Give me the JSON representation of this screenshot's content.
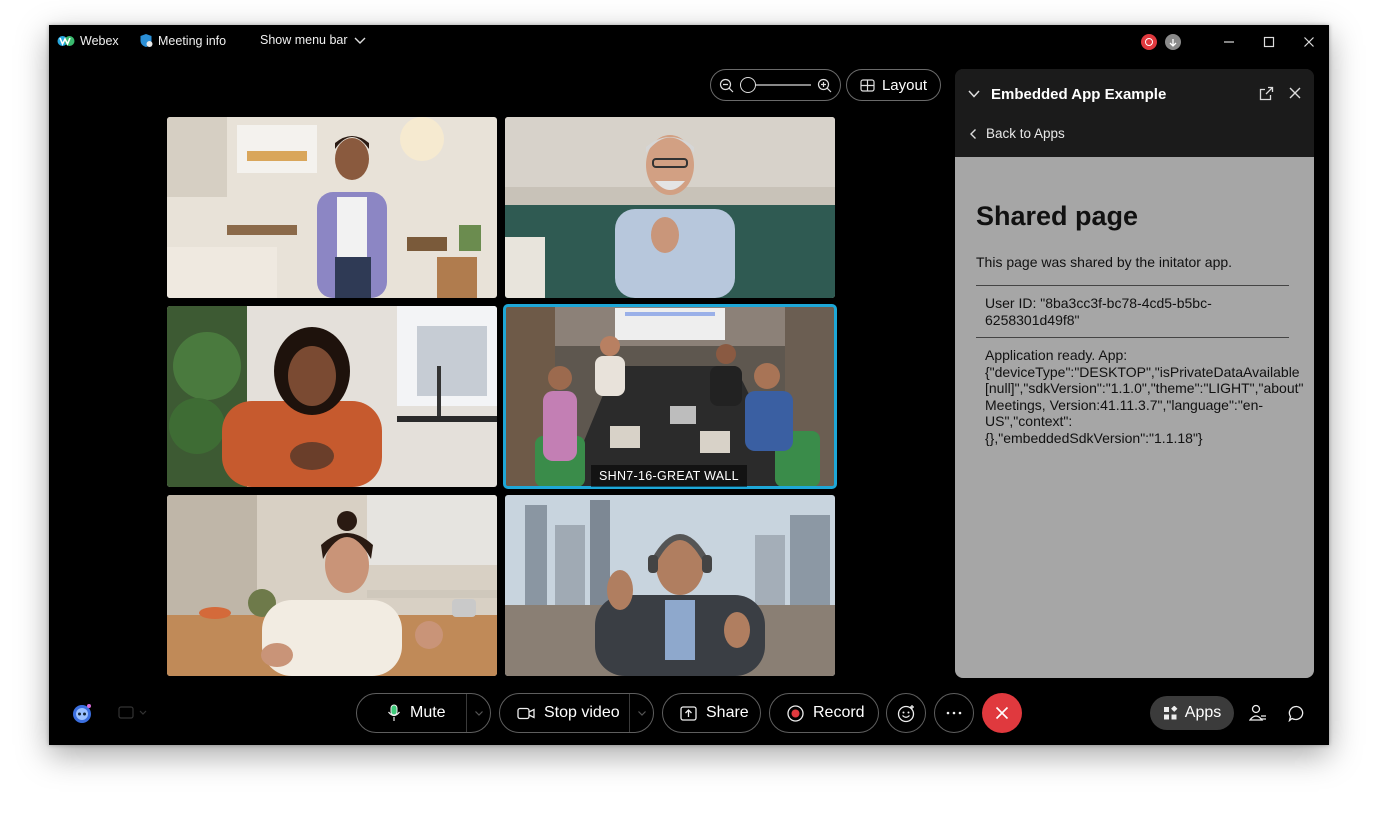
{
  "titlebar": {
    "app_name": "Webex",
    "meeting_info": "Meeting info",
    "show_menu_bar": "Show menu bar"
  },
  "video": {
    "layout_label": "Layout",
    "active_tile_label": "SHN7-16-GREAT WALL"
  },
  "panel": {
    "title": "Embedded App Example",
    "back_label": "Back to Apps",
    "heading": "Shared page",
    "description": "This page was shared by the initator app.",
    "user_id_text": "User ID: \"8ba3cc3f-bc78-4cd5-b5bc-\n6258301d49f8\"",
    "app_ready_text": "Application ready. App:\n{\"deviceType\":\"DESKTOP\",\"isPrivateDataAvailable\n[null]\",\"sdkVersion\":\"1.1.0\",\"theme\":\"LIGHT\",\"about\"\nMeetings, Version:41.11.3.7\",\"language\":\"en-\nUS\",\"context\":\n{},\"embeddedSdkVersion\":\"1.1.18\"}"
  },
  "controls": {
    "mute_label": "Mute",
    "stop_video_label": "Stop video",
    "share_label": "Share",
    "record_label": "Record",
    "apps_label": "Apps"
  },
  "colors": {
    "accent_active_tile": "#1ea7d7",
    "end_call": "#e0393e",
    "record_dot": "#e0393e",
    "panel_body_bg": "#a6a6a6"
  },
  "icons": {
    "webex_logo": "webex-logo-icon",
    "meeting_info": "shield-info-icon",
    "chevron": "chevron-down-icon",
    "zoom_out": "zoom-out-icon",
    "zoom_in": "zoom-in-icon",
    "layout": "grid-icon",
    "microphone": "microphone-icon",
    "camera": "camera-icon",
    "share": "share-screen-icon",
    "record": "record-icon",
    "reactions": "emoji-icon",
    "more": "more-icon",
    "end_call": "close-icon",
    "apps": "apps-icon",
    "participants": "participants-icon",
    "chat": "chat-icon"
  }
}
